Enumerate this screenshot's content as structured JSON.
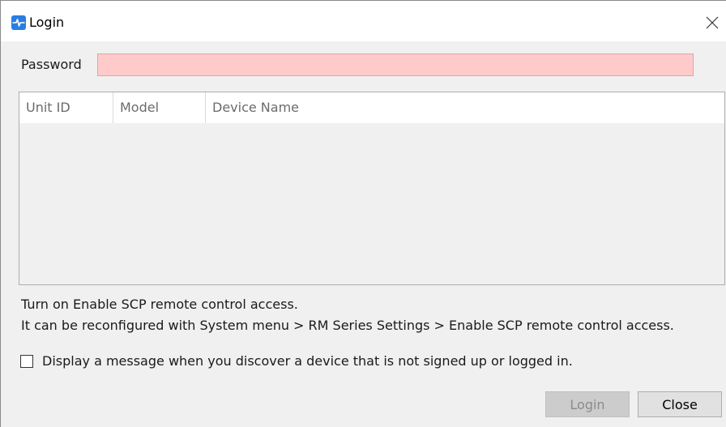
{
  "window": {
    "title": "Login",
    "accent_color": "#2a7de1"
  },
  "password": {
    "label": "Password",
    "value": "",
    "field_color": "#fecaca"
  },
  "table": {
    "columns": [
      "Unit ID",
      "Model",
      "Device Name"
    ],
    "rows": []
  },
  "info": {
    "line1": "Turn on Enable SCP remote control access.",
    "line2": "It can be reconfigured with System menu > RM Series Settings > Enable SCP remote control access."
  },
  "option": {
    "label": "Display a message when you discover a device that is not signed up or logged in.",
    "checked": false
  },
  "buttons": {
    "login_label": "Login",
    "close_label": "Close"
  },
  "icons": {
    "app": "app-logo-icon",
    "close": "close-icon"
  }
}
